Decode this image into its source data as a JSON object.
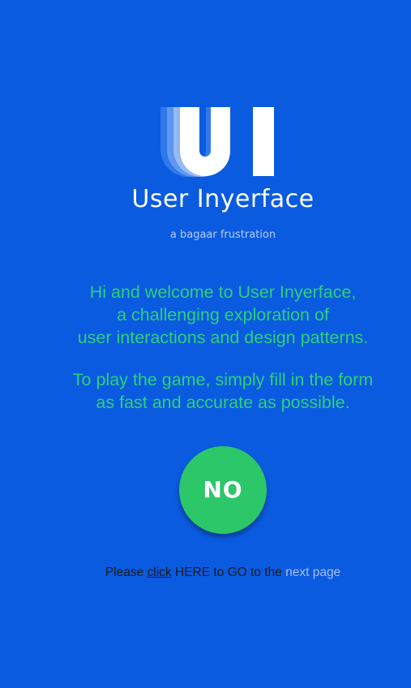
{
  "logo": {
    "icon": "ui-logo-icon",
    "letters": "UI",
    "title": "User Inyerface",
    "subtitle": "a bagaar frustration"
  },
  "intro": {
    "lines_a": [
      "Hi and welcome to User Inyerface,",
      "a challenging exploration of",
      "user interactions and design patterns."
    ],
    "lines_b": [
      "To play the game, simply fill in the form",
      "as fast and accurate as possible."
    ]
  },
  "no_button": {
    "label": "NO"
  },
  "nav": {
    "prefix": "Please",
    "click_link": "click",
    "middle": "HERE to GO to the",
    "next_link": "next page"
  },
  "colors": {
    "background": "#0a5be0",
    "intro_text": "#2ed07b",
    "button": "#2bc768",
    "next_link": "#a6bff0"
  }
}
